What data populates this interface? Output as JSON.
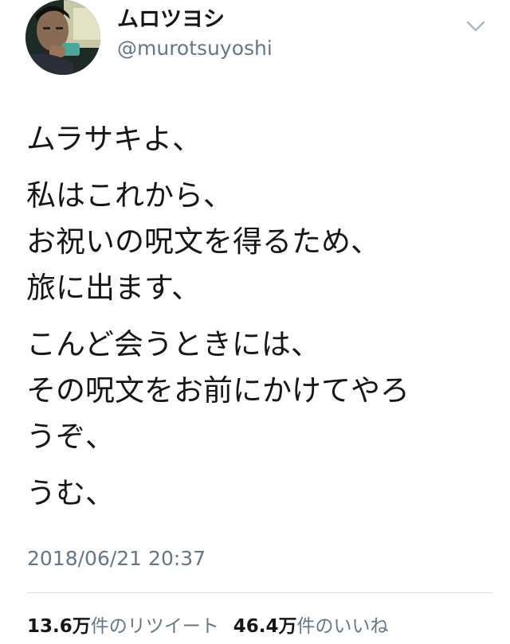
{
  "user": {
    "display_name": "ムロツヨシ",
    "handle": "@murotsuyoshi"
  },
  "menu": {
    "icon": "chevron-down-icon"
  },
  "tweet": {
    "paragraphs": [
      [
        "ムラサキよ、"
      ],
      [
        "私はこれから、",
        "お祝いの呪文を得るため、",
        "旅に出ます、"
      ],
      [
        "こんど会うときには、",
        "その呪文をお前にかけてやろ",
        "うぞ、"
      ],
      [
        "うむ、"
      ]
    ],
    "timestamp": "2018/06/21 20:37"
  },
  "stats": {
    "retweets_count": "13.6万",
    "retweets_label": "件のリツイート",
    "likes_count": "46.4万",
    "likes_label": "件のいいね"
  },
  "colors": {
    "text_primary": "#14171a",
    "text_secondary": "#657786",
    "divider": "#d9dee2"
  }
}
